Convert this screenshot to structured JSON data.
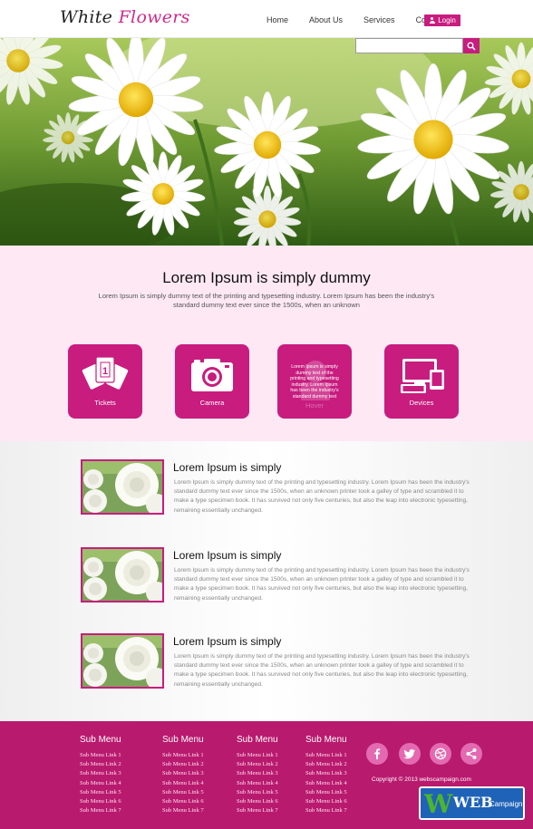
{
  "header": {
    "logo_main": "White",
    "logo_accent": "Flowers",
    "nav": [
      "Home",
      "About Us",
      "Services",
      "Contact"
    ],
    "login_label": "Login"
  },
  "search": {
    "value": ""
  },
  "intro": {
    "title": "Lorem Ipsum is simply dummy",
    "text": "Lorem Ipsum is simply dummy text of the printing and typesetting industry. Lorem Ipsum has been the industry's standard dummy text ever since the 1500s, when an unknown",
    "tiles": [
      {
        "label": "Tickets",
        "icon": "tickets-icon"
      },
      {
        "label": "Camera",
        "icon": "camera-icon"
      },
      {
        "label": "",
        "hover_text": "Lorem Ipsum is simply dummy text of the printing and typesetting industry. Lorem Ipsum has been the industry's standard dummy text",
        "ghost_label": "Hover",
        "icon": "hover-tile"
      },
      {
        "label": "Devices",
        "icon": "devices-icon"
      }
    ]
  },
  "articles": [
    {
      "title": "Lorem Ipsum is simply",
      "text": "Lorem Ipsum is simply dummy text of the printing and typesetting industry. Lorem Ipsum has been the industry's standard dummy text ever since the 1500s, when an unknown printer took a galley of type and scrambled it to make a type specimen book. It has survived not only five centuries, but also the leap into electronic typesetting, remaining essentially unchanged."
    },
    {
      "title": "Lorem Ipsum is simply",
      "text": "Lorem Ipsum is simply dummy text of the printing and typesetting industry. Lorem Ipsum has been the industry's standard dummy text ever since the 1500s, when an unknown printer took a galley of type and scrambled it to make a type specimen book. It has survived not only five centuries, but also the leap into electronic typesetting, remaining essentially unchanged."
    },
    {
      "title": "Lorem Ipsum is simply",
      "text": "Lorem Ipsum is simply dummy text of the printing and typesetting industry. Lorem Ipsum has been the industry's standard dummy text ever since the 1500s, when an unknown printer took a galley of type and scrambled it to make a type specimen book. It has survived not only five centuries, but also the leap into electronic typesetting, remaining essentially unchanged."
    }
  ],
  "footer": {
    "menus": [
      {
        "title": "Sub Menu",
        "links": [
          "Sub Menu Link 1",
          "Sub Menu Link 2",
          "Sub Menu Link 3",
          "Sub Menu Link 4",
          "Sub Menu Link 5",
          "Sub Menu Link 6",
          "Sub Menu Link 7"
        ]
      },
      {
        "title": "Sub Menu",
        "links": [
          "Sub Menu Link 1",
          "Sub Menu Link 2",
          "Sub Menu Link 3",
          "Sub Menu Link 4",
          "Sub Menu Link 5",
          "Sub Menu Link 6",
          "Sub Menu Link 7"
        ]
      },
      {
        "title": "Sub Menu",
        "links": [
          "Sub Menu Link 1",
          "Sub Menu Link 2",
          "Sub Menu Link 3",
          "Sub Menu Link 4",
          "Sub Menu Link 5",
          "Sub Menu Link 6",
          "Sub Menu Link 7"
        ]
      },
      {
        "title": "Sub Menu",
        "links": [
          "Sub Menu Link 1",
          "Sub Menu Link 2",
          "Sub Menu Link 3",
          "Sub Menu Link 4",
          "Sub Menu Link 5",
          "Sub Menu Link 6",
          "Sub Menu Link 7"
        ]
      }
    ],
    "social": [
      "facebook-icon",
      "twitter-icon",
      "dribbble-icon",
      "share-icon"
    ],
    "copyright": "Copyright © 2013 webscampaign.com"
  },
  "badge": {
    "w": "W",
    "web": "WEB",
    "campaign": "Campaign"
  },
  "colors": {
    "accent": "#c81c7f",
    "footer": "#b81a6e",
    "intro_bg": "#fde8f4"
  }
}
